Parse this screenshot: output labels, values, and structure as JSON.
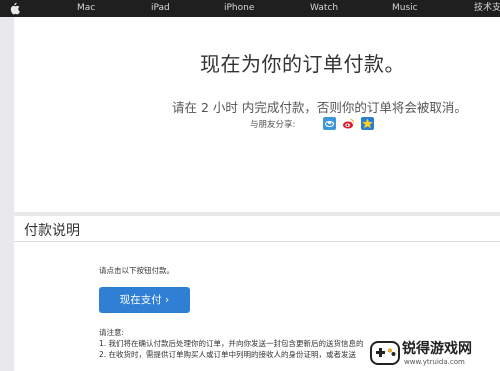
{
  "nav": {
    "items": [
      "Mac",
      "iPad",
      "iPhone",
      "Watch",
      "Music",
      "技术支持"
    ]
  },
  "confirm": {
    "heading": "现在为你的订单付款。",
    "subtitle": "请在 2 小时 内完成付款，否则你的订单将会被取消。",
    "share_label": "与朋友分享:",
    "share_icons": [
      "qzone-icon",
      "weibo-icon",
      "favorite-star-icon"
    ]
  },
  "instructions": {
    "title": "付款说明",
    "prompt": "请点击以下按钮付款。",
    "pay_button": "现在支付 ›",
    "note_title": "请注意:",
    "notes": [
      "1. 我们将在确认付款后处理你的订单，并向你发送一封包含更新后的送货信息的",
      "2. 在收货时，需提供订单购买人或订单中列明的接收人的身份证明，或者发送"
    ]
  },
  "watermark": {
    "name": "锐得游戏网",
    "url": "www.ytruida.com"
  },
  "colors": {
    "nav_bg": "#1f1f1f",
    "accent": "#2f7fd5",
    "page_bg": "#e9e9eb"
  }
}
